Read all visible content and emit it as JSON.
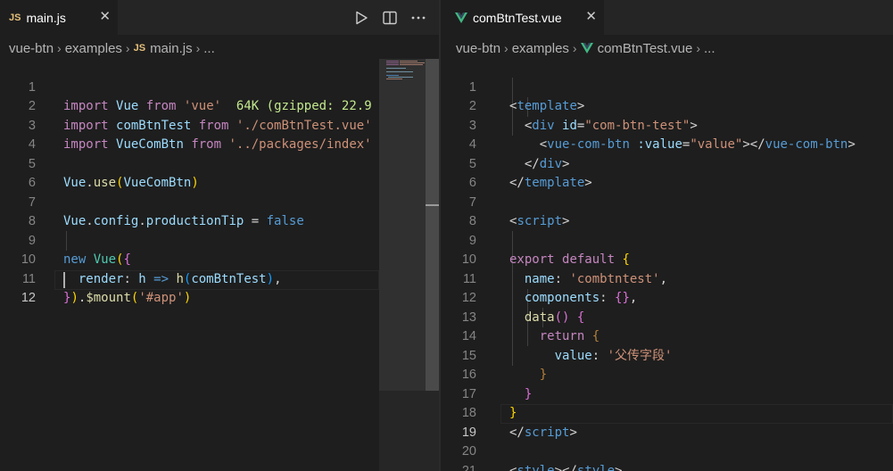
{
  "left": {
    "tab": {
      "badge": "JS",
      "label": "main.js",
      "close": "✕"
    },
    "actions": {
      "run": "run-icon",
      "split": "split-editor-icon",
      "more": "more-actions-icon"
    },
    "breadcrumb": {
      "root": "vue-btn",
      "folder": "examples",
      "file_badge": "JS",
      "file": "main.js",
      "tail": "..."
    },
    "lines": [
      {
        "n": "1"
      },
      {
        "n": "2"
      },
      {
        "n": "3"
      },
      {
        "n": "4"
      },
      {
        "n": "5"
      },
      {
        "n": "6"
      },
      {
        "n": "7"
      },
      {
        "n": "8"
      },
      {
        "n": "9"
      },
      {
        "n": "10"
      },
      {
        "n": "11"
      },
      {
        "n": "12"
      }
    ],
    "code": {
      "l1": {
        "k": "import",
        "id": "Vue",
        "from": "from",
        "s": "'vue'",
        "hint": "  64K (gzipped: 22.9"
      },
      "l2": {
        "k": "import",
        "id": "comBtnTest",
        "from": "from",
        "s": "'./comBtnTest.vue'"
      },
      "l3": {
        "k": "import",
        "id": "VueComBtn",
        "from": "from",
        "s": "'../packages/index'"
      },
      "l5": {
        "obj": "Vue",
        "dot": ".",
        "fn": "use",
        "p1": "(",
        "arg": "VueComBtn",
        "p2": ")"
      },
      "l7": {
        "obj": "Vue",
        "d1": ".",
        "p1": "config",
        "d2": ".",
        "p2": "productionTip",
        "eq": " = ",
        "v": "false"
      },
      "l9": {
        "k": "new",
        "sp": " ",
        "cls": "Vue",
        "p": "(",
        "b": "{"
      },
      "l10": {
        "ind": "  ",
        "key": "render",
        "colon": ": ",
        "h": "h",
        "arrow": " => ",
        "fn": "h",
        "p1": "(",
        "arg": "comBtnTest",
        "p2": ")",
        "comma": ","
      },
      "l11": {
        "b": "}",
        "p": ")",
        "dot": ".",
        "fn": "$mount",
        "p1": "(",
        "s": "'#app'",
        "p2": ")"
      }
    }
  },
  "right": {
    "tab": {
      "label": "comBtnTest.vue",
      "close": "✕"
    },
    "breadcrumb": {
      "root": "vue-btn",
      "folder": "examples",
      "file": "comBtnTest.vue",
      "tail": "..."
    },
    "lines": [
      {
        "n": "1"
      },
      {
        "n": "2"
      },
      {
        "n": "3"
      },
      {
        "n": "4"
      },
      {
        "n": "5"
      },
      {
        "n": "6"
      },
      {
        "n": "7"
      },
      {
        "n": "8"
      },
      {
        "n": "9"
      },
      {
        "n": "10"
      },
      {
        "n": "11"
      },
      {
        "n": "12"
      },
      {
        "n": "13"
      },
      {
        "n": "14"
      },
      {
        "n": "15"
      },
      {
        "n": "16"
      },
      {
        "n": "17"
      },
      {
        "n": "18"
      },
      {
        "n": "19"
      },
      {
        "n": "20"
      },
      {
        "n": "21"
      }
    ],
    "code": {
      "l1": {
        "lt": "<",
        "tag": "template",
        "gt": ">"
      },
      "l2": {
        "ind": "  ",
        "lt": "<",
        "tag": "div",
        "sp": " ",
        "attr": "id",
        "eq": "=",
        "val": "\"com-btn-test\"",
        "gt": ">"
      },
      "l3": {
        "ind": "    ",
        "lt": "<",
        "tag": "vue-com-btn",
        "sp": " ",
        "attr": ":value",
        "eq": "=",
        "val": "\"value\"",
        "gt": "></",
        "tag2": "vue-com-btn",
        "gt2": ">"
      },
      "l4": {
        "ind": "  ",
        "lt": "</",
        "tag": "div",
        "gt": ">"
      },
      "l5": {
        "lt": "</",
        "tag": "template",
        "gt": ">"
      },
      "l7": {
        "lt": "<",
        "tag": "script",
        "gt": ">"
      },
      "l9": {
        "k": "export",
        "sp": " ",
        "k2": "default",
        "sp2": " ",
        "b": "{"
      },
      "l10": {
        "ind": "  ",
        "key": "name",
        "colon": ": ",
        "s": "'combtntest'",
        "comma": ","
      },
      "l11": {
        "ind": "  ",
        "key": "components",
        "colon": ": ",
        "b": "{}",
        "comma": ","
      },
      "l12": {
        "ind": "  ",
        "fn": "data",
        "p": "()",
        "sp": " ",
        "b": "{"
      },
      "l13": {
        "ind": "    ",
        "k": "return",
        "sp": " ",
        "b": "{"
      },
      "l14": {
        "ind": "      ",
        "key": "value",
        "colon": ": ",
        "s": "'父传字段'"
      },
      "l15": {
        "ind": "    ",
        "b": "}"
      },
      "l16": {
        "ind": "  ",
        "b": "}"
      },
      "l17": {
        "b": "}"
      },
      "l18": {
        "lt": "</",
        "tag": "script",
        "gt": ">"
      },
      "l20": {
        "lt": "<",
        "tag": "style",
        "gt": "></",
        "tag2": "style",
        "gt2": ">"
      }
    }
  },
  "colors": {
    "background": "#1e1e1e",
    "tabbar": "#252526",
    "vue_green": "#41b883",
    "js_yellow": "#e5c07b"
  }
}
